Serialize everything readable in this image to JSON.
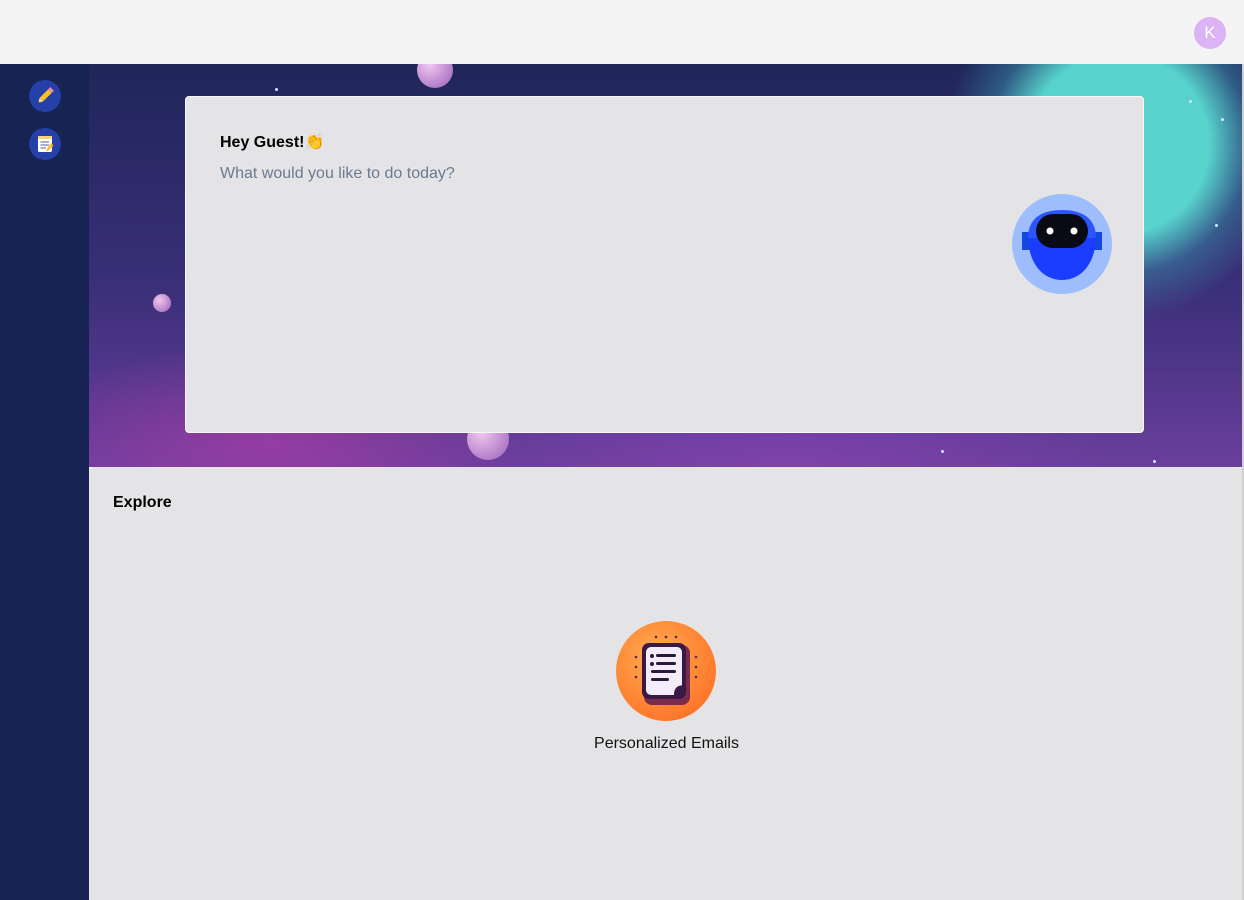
{
  "header": {
    "user_initial": "K"
  },
  "sidebar": {
    "items": [
      {
        "name": "new-writing",
        "icon": "pencil-icon"
      },
      {
        "name": "documents",
        "icon": "memo-icon"
      }
    ]
  },
  "greeting": {
    "title": "Hey Guest!",
    "emoji": "👏",
    "subtitle": "What would you like to do today?"
  },
  "explore": {
    "title": "Explore",
    "tools": [
      {
        "label": "Personalized Emails",
        "icon": "document-icon"
      }
    ]
  },
  "colors": {
    "sidebar": "#172353",
    "card": "#e4e4e7",
    "avatar": "#dcb4f6",
    "accent_orange": "#ff7a2c",
    "bot_blue": "#1b3dff"
  }
}
